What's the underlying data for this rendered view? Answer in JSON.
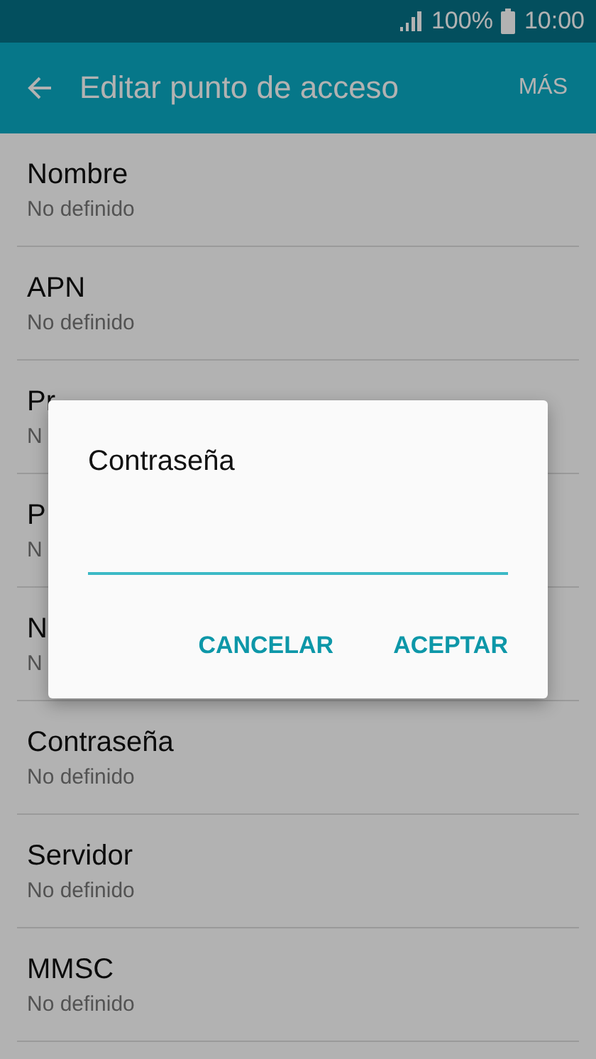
{
  "status_bar": {
    "battery": "100%",
    "time": "10:00"
  },
  "app_bar": {
    "title": "Editar punto de acceso",
    "action": "MÁS"
  },
  "settings": [
    {
      "label": "Nombre",
      "value": "No definido"
    },
    {
      "label": "APN",
      "value": "No definido"
    },
    {
      "label": "Pr",
      "value": "N"
    },
    {
      "label": "P",
      "value": "N"
    },
    {
      "label": "N",
      "value": "N"
    },
    {
      "label": "Contraseña",
      "value": "No definido"
    },
    {
      "label": "Servidor",
      "value": "No definido"
    },
    {
      "label": "MMSC",
      "value": "No definido"
    }
  ],
  "dialog": {
    "title": "Contraseña",
    "buttons": [
      "CANCELAR",
      "ACEPTAR"
    ]
  }
}
